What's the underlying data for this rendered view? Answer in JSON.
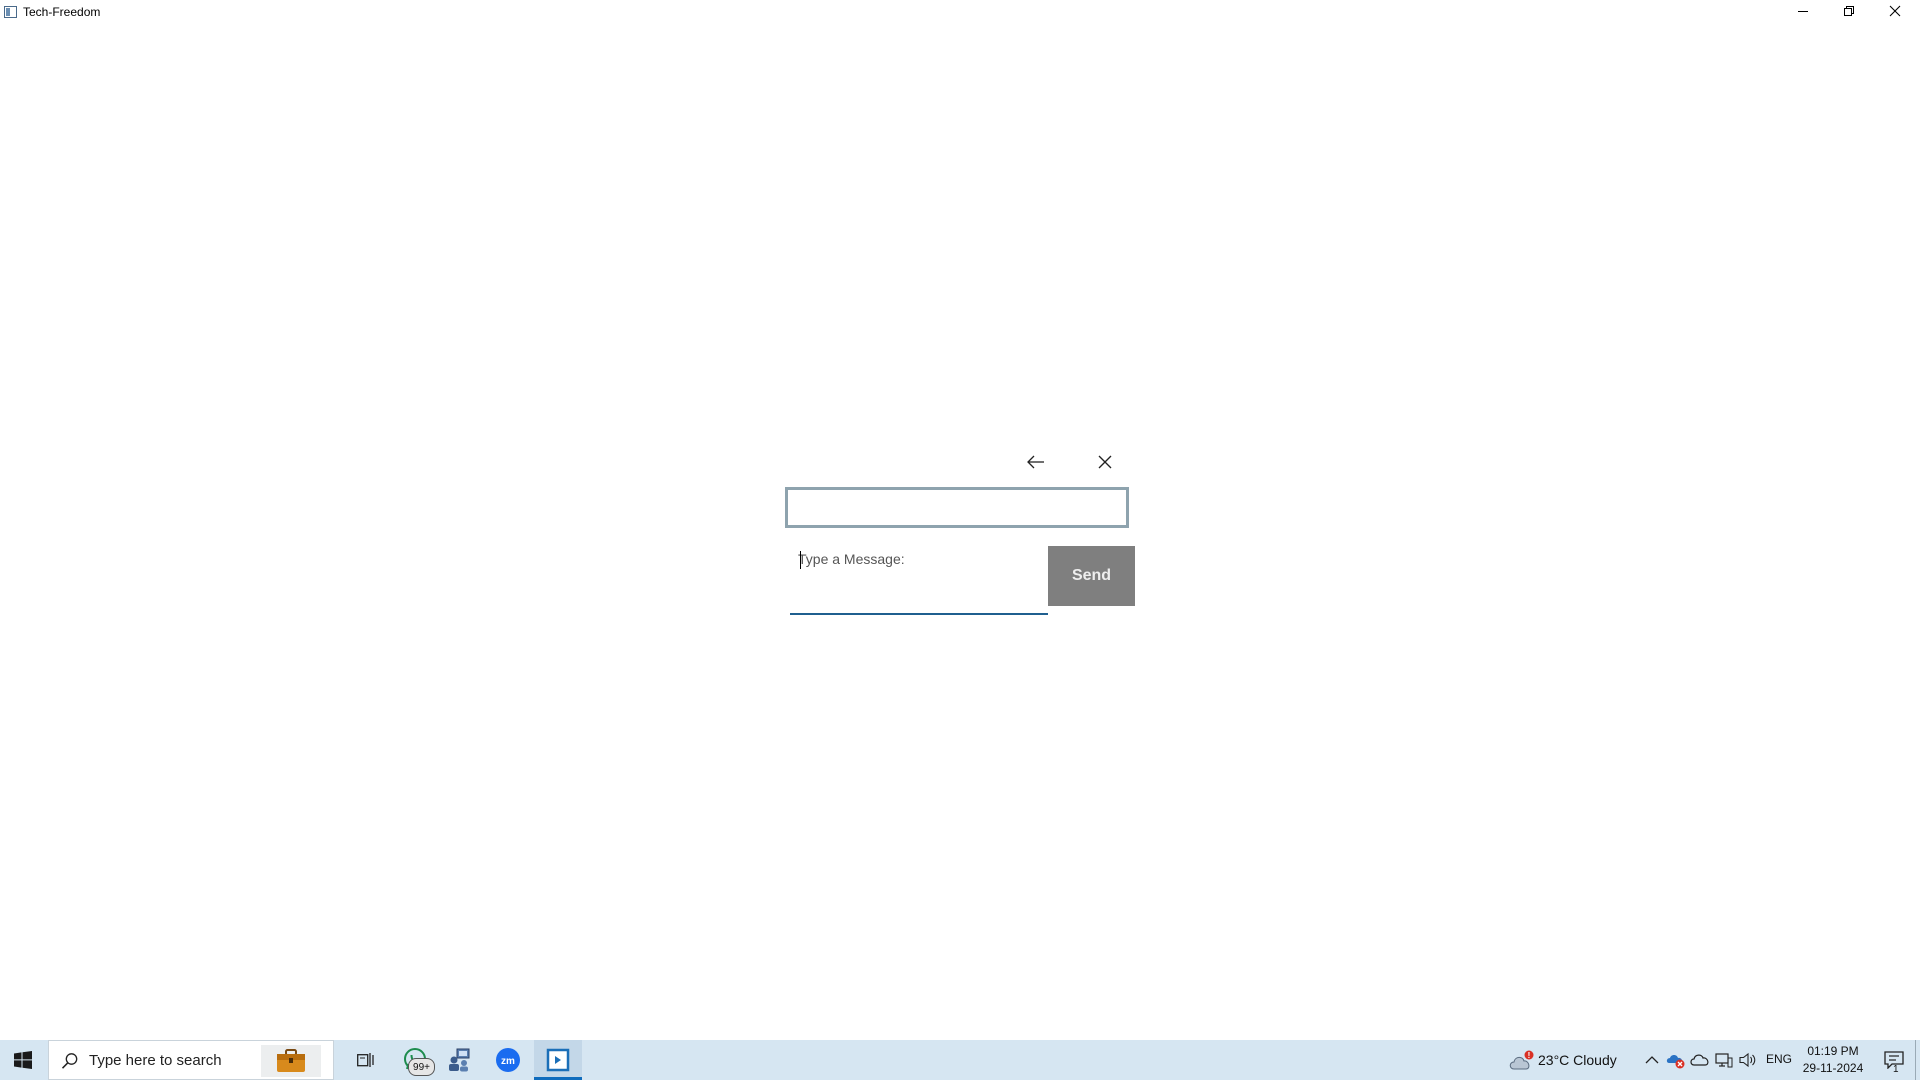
{
  "window": {
    "title": "Tech-Freedom",
    "controls": [
      "minimize",
      "restore",
      "close"
    ]
  },
  "dialog": {
    "top_field_value": "",
    "message_placeholder": "Type a Message:",
    "message_value": "",
    "send_label": "Send",
    "nav_icons": [
      "arrow-left-icon",
      "close-icon"
    ]
  },
  "taskbar": {
    "search_placeholder": "Type here to search",
    "whatsapp_badge": "99+",
    "weather": {
      "text": "23°C  Cloudy",
      "alert": "!"
    },
    "language": "ENG",
    "time": "01:19 PM",
    "date": "29-11-2024",
    "notification_count": "1",
    "pinned_icons": [
      "start-icon",
      "search-icon",
      "briefcase-icon",
      "task-view-icon",
      "whatsapp-icon",
      "network-people-icon",
      "zoom-icon",
      "app-window-icon"
    ],
    "tray_icons": [
      "chevron-up-icon",
      "onedrive-error-icon",
      "cloud-icon",
      "network-icon",
      "volume-icon"
    ]
  },
  "colors": {
    "taskbar_bg": "#d6e6f2",
    "send_bg": "#7f7f7f",
    "field_border": "#8ea3ae",
    "message_underline": "#1f5f8f",
    "accent": "#0f6cbd"
  }
}
